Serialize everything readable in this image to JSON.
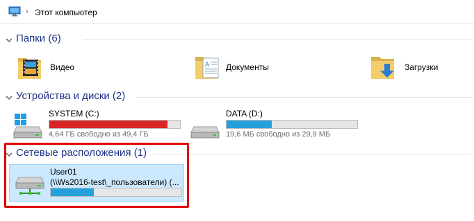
{
  "address": {
    "crumb": "Этот компьютер",
    "separator": "›"
  },
  "sections": {
    "folders": {
      "title": "Папки (6)"
    },
    "drives": {
      "title": "Устройства и диски (2)"
    },
    "network": {
      "title": "Сетевые расположения (1)"
    }
  },
  "folders": [
    {
      "name": "Видео",
      "icon": "video-folder-icon"
    },
    {
      "name": "Документы",
      "icon": "documents-folder-icon"
    },
    {
      "name": "Загрузки",
      "icon": "downloads-folder-icon"
    }
  ],
  "drives": [
    {
      "name": "SYSTEM (C:)",
      "free_text": "4,64 ГБ свободно из 49,4 ГБ",
      "used_fraction": 0.906,
      "bar_color": "#da2626",
      "icon": "windows-drive-icon"
    },
    {
      "name": "DATA (D:)",
      "free_text": "19,6 МБ свободно из 29,9 МБ",
      "used_fraction": 0.345,
      "bar_color": "#26a0da",
      "icon": "drive-icon"
    }
  ],
  "network_locations": [
    {
      "name": "User01",
      "path": "(\\\\Ws2016-test\\_пользователи) (...",
      "used_fraction": 0.33,
      "bar_color": "#26a0da",
      "icon": "network-drive-icon"
    }
  ],
  "colors": {
    "section_title": "#1e3287",
    "selected_bg": "#cce8ff",
    "highlight_border": "#e00000"
  }
}
